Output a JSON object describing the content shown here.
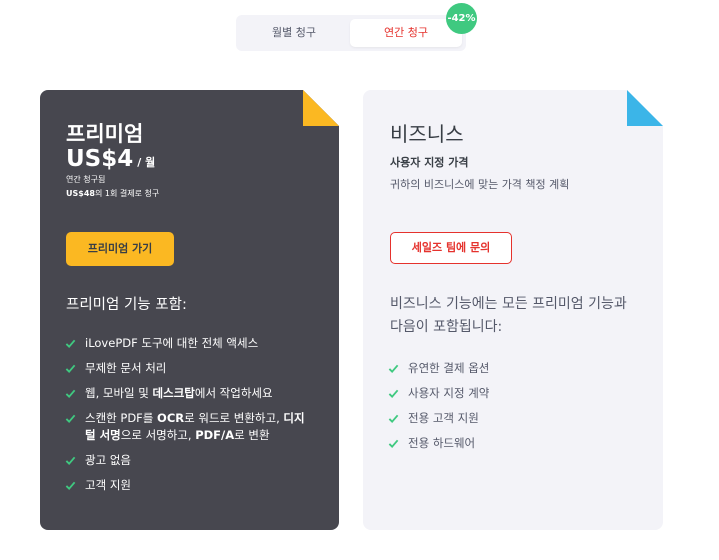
{
  "billing_toggle": {
    "monthly_label": "월별 청구",
    "annual_label": "연간 청구",
    "discount_badge": "-42%"
  },
  "premium": {
    "title": "프리미엄",
    "price": "US$4",
    "period": "/ 월",
    "billed_note": "연간 청구됨",
    "yearly_amount": "US$48",
    "yearly_suffix": "의 1회 결제로 청구",
    "cta_label": "프리미엄 가기",
    "features_heading": "프리미엄 기능 포함:",
    "features": [
      {
        "text": "iLovePDF 도구에 대한 전체 액세스"
      },
      {
        "text": "무제한 문서 처리"
      },
      {
        "t1": "웹, 모바일 및 ",
        "b1": "데스크탑",
        "t2": "에서 작업하세요"
      },
      {
        "t1": "스캔한 PDF를 ",
        "b1": "OCR",
        "t2": "로 워드로 변환하고, ",
        "b2": "디지털 서명",
        "t3": "으로 서명하고, ",
        "b3": "PDF/A",
        "t4": "로 변환"
      },
      {
        "text": "광고 없음"
      },
      {
        "text": "고객 지원"
      }
    ],
    "accent_color": "#fbb822"
  },
  "business": {
    "title": "비즈니스",
    "subtitle": "사용자 지정 가격",
    "description": "귀하의 비즈니스에 맞는 가격 책정 계획",
    "cta_label": "세일즈 팀에 문의",
    "features_heading": "비즈니스 기능에는 모든 프리미엄 기능과 다음이 포함됩니다:",
    "features": [
      {
        "text": "유연한 결제 옵션"
      },
      {
        "text": "사용자 지정 계약"
      },
      {
        "text": "전용 고객 지원"
      },
      {
        "text": "전용 하드웨어"
      }
    ],
    "accent_color": "#3bb5e8"
  },
  "colors": {
    "check": "#3fc980",
    "brand_red": "#e5322d",
    "premium_bg": "#47474f",
    "business_bg": "#f3f3f8"
  },
  "icons": {
    "check": "check-icon",
    "corner_fold": "folded-corner-icon"
  }
}
